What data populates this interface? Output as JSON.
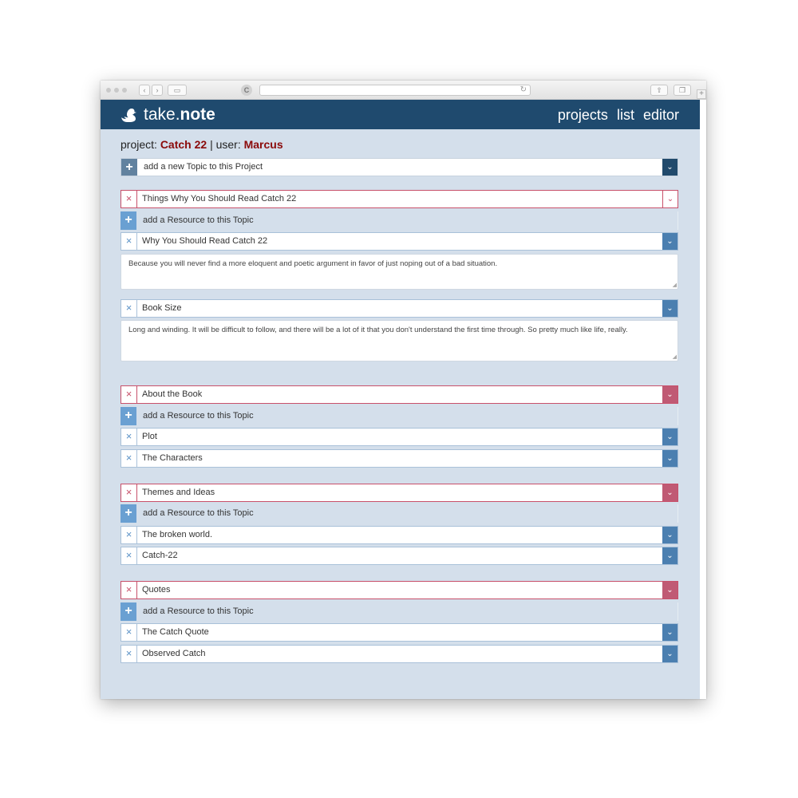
{
  "app": {
    "brand_prefix": "take.",
    "brand_bold": "note",
    "nav": [
      "projects",
      "list",
      "editor"
    ]
  },
  "context": {
    "project_label": "project:",
    "project_name": "Catch 22",
    "separator": "|",
    "user_label": "user:",
    "user_name": "Marcus"
  },
  "new_topic_label": "add a new Topic to this Project",
  "add_resource_label": "add a Resource to this Topic",
  "icons": {
    "plus": "+",
    "close": "×",
    "chevron": "⌄"
  },
  "topics": [
    {
      "title": "Things Why You Should Read Catch 22",
      "resources": [
        {
          "title": "Why You Should Read Catch 22",
          "note": "Because you will never find a more eloquent and poetic argument in favor of just noping out of a bad situation."
        },
        {
          "title": "Book Size",
          "note": "Long and winding. It will be difficult to follow, and there will be a lot of it that you don't understand the first time through. So pretty much like life, really."
        }
      ]
    },
    {
      "title": "About the Book",
      "resources": [
        {
          "title": "Plot"
        },
        {
          "title": "The Characters"
        }
      ]
    },
    {
      "title": "Themes and Ideas",
      "resources": [
        {
          "title": "The broken world."
        },
        {
          "title": "Catch-22"
        }
      ]
    },
    {
      "title": "Quotes",
      "resources": [
        {
          "title": "The Catch Quote"
        },
        {
          "title": "Observed Catch"
        }
      ]
    }
  ],
  "colors": {
    "header": "#1f4a6e",
    "page_bg": "#d4dfeb",
    "accent_red": "#8b0a0a",
    "topic_border": "#c8506a",
    "resource_button": "#4b7fb0"
  }
}
